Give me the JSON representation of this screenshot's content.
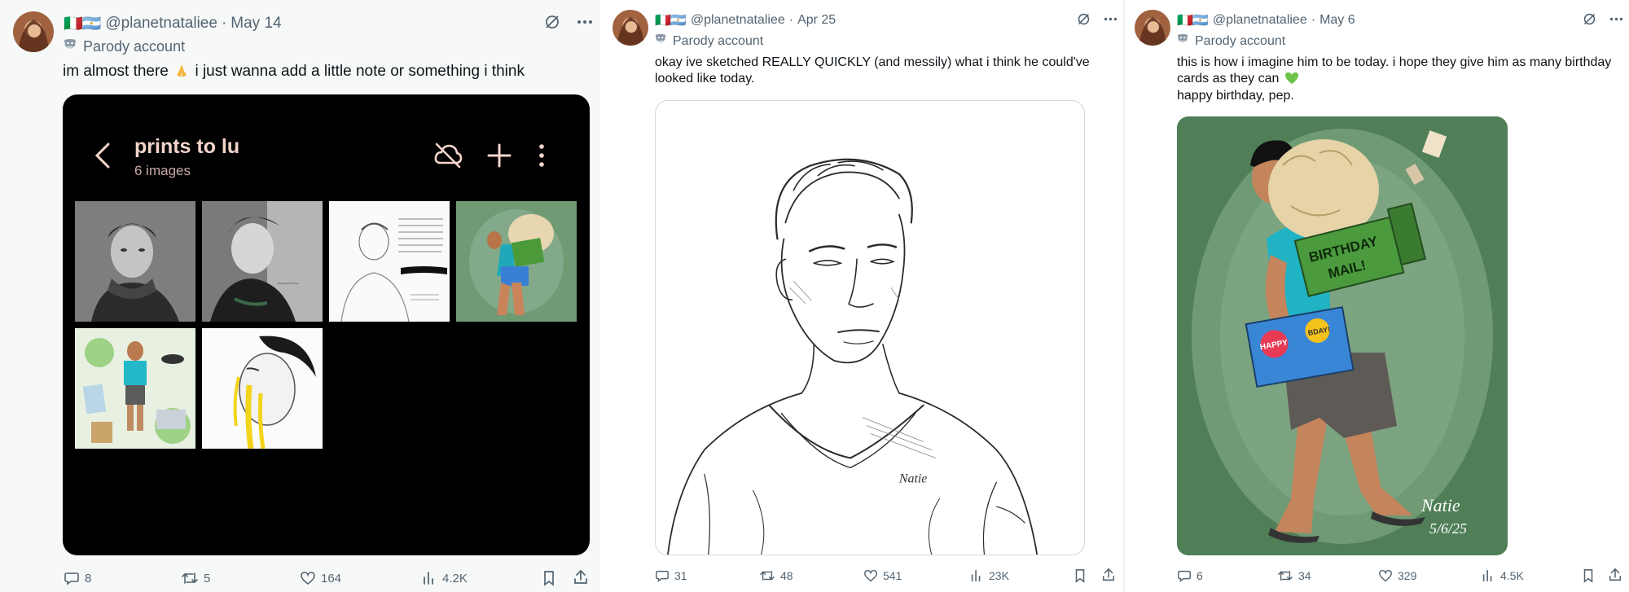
{
  "posts": [
    {
      "header": {
        "flags": "🇮🇹🇦🇷",
        "handle": "@planetnataliee",
        "sep": "·",
        "date": "May 14"
      },
      "parody_label": "Parody account",
      "text_before": "im almost there",
      "text_after": "i just wanna add a little note or something i think",
      "gallery": {
        "title": "prints to lu",
        "subtitle": "6 images"
      },
      "stats": {
        "replies": "8",
        "reposts": "5",
        "likes": "164",
        "views": "4.2K"
      }
    },
    {
      "header": {
        "flags": "🇮🇹🇦🇷",
        "handle": "@planetnataliee",
        "sep": "·",
        "date": "Apr 25"
      },
      "parody_label": "Parody account",
      "text_line1": "okay ive sketched REALLY QUICKLY (and messily) what i think he could've",
      "text_line2": "looked like today.",
      "stats": {
        "replies": "31",
        "reposts": "48",
        "likes": "541",
        "views": "23K"
      }
    },
    {
      "header": {
        "flags": "🇮🇹🇦🇷",
        "handle": "@planetnataliee",
        "sep": "·",
        "date": "May 6"
      },
      "parody_label": "Parody account",
      "text_line1": "this is how i imagine him to be today. i hope they give him as many birthday",
      "text_line2": "cards as they can",
      "text_line3": "happy birthday, pep.",
      "artwork": {
        "box_text_1": "BIRTHDAY",
        "box_text_2": "MAIL!",
        "card_text_1": "HAPPY",
        "card_text_2": "BDAY!",
        "signature_date": "5/6/25"
      },
      "stats": {
        "replies": "6",
        "reposts": "34",
        "likes": "329",
        "views": "4.5K"
      }
    }
  ],
  "colors": {
    "text_primary": "#0f1419",
    "text_secondary": "#536471",
    "gallery_bg": "#000000",
    "gallery_title": "#f3d4cb",
    "heart_green": "#6cc24a",
    "art_green": "#6f9a74"
  },
  "icons": [
    "grok-icon",
    "more-icon",
    "parody-mask-icon",
    "reply-icon",
    "repost-icon",
    "like-icon",
    "views-icon",
    "bookmark-icon",
    "share-icon",
    "back-icon",
    "cloud-off-icon",
    "plus-icon",
    "kebab-icon"
  ]
}
